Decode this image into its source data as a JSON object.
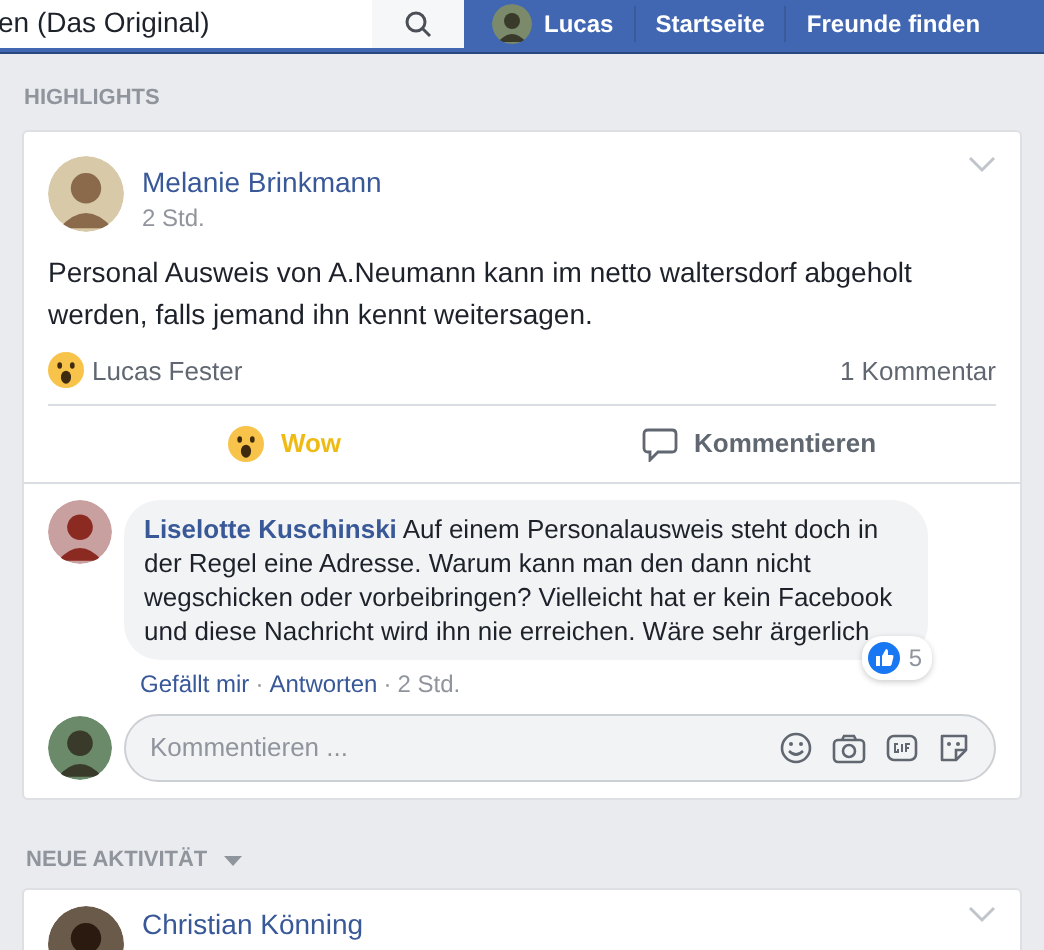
{
  "topbar": {
    "search_value": "en (Das Original)",
    "nav": [
      {
        "kind": "profile",
        "label": "Lucas"
      },
      {
        "kind": "link",
        "label": "Startseite"
      },
      {
        "kind": "link",
        "label": "Freunde finden"
      }
    ]
  },
  "highlights": {
    "heading": "HIGHLIGHTS",
    "post": {
      "author": "Melanie Brinkmann",
      "time": "2 Std.",
      "text": "Personal Ausweis von A.Neumann kann im netto waltersdorf abgeholt werden, falls jemand ihn kennt weitersagen.",
      "reactor": "Lucas Fester",
      "comment_count": "1 Kommentar",
      "actions": [
        {
          "kind": "wow",
          "label": "Wow",
          "selected": true
        },
        {
          "kind": "comment",
          "label": "Kommentieren",
          "selected": false
        }
      ],
      "comments": [
        {
          "author": "Liselotte Kuschinski",
          "text": "Auf einem Personalausweis steht doch in der Regel eine Adresse. Warum kann man den dann nicht wegschicken oder vorbeibringen? Vielleicht hat er kein Facebook und diese Nachricht wird ihn nie erreichen. Wäre sehr ärgerlich",
          "likes": "5",
          "links": [
            "Gefällt mir",
            "Antworten"
          ],
          "separator": "·",
          "time": "2 Std."
        }
      ],
      "composer_placeholder": "Kommentieren ..."
    }
  },
  "activity": {
    "heading": "NEUE AKTIVITÄT",
    "post": {
      "author": "Christian Könning"
    }
  }
}
